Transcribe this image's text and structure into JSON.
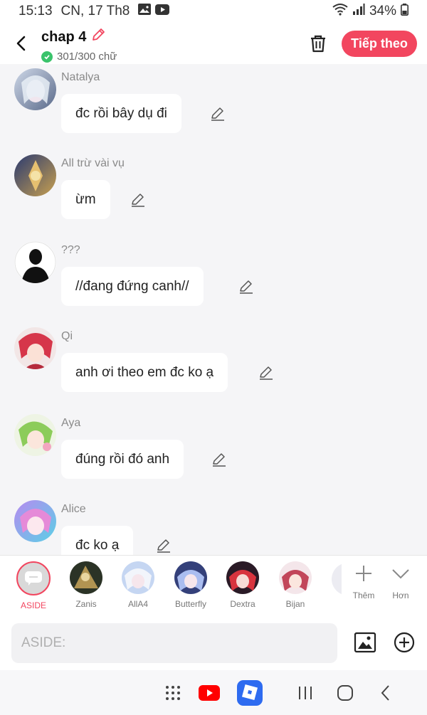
{
  "status_bar": {
    "time": "15:13",
    "date": "CN, 17 Th8",
    "battery": "34%",
    "icons": [
      "gallery-icon",
      "youtube-icon",
      "wifi-icon",
      "signal-icon",
      "battery-icon"
    ]
  },
  "header": {
    "title": "chap 4",
    "word_count": "301/300 chữ",
    "next_label": "Tiếp theo"
  },
  "messages": [
    {
      "sender": "Natalya",
      "text": "đc rồi bây dụ đi"
    },
    {
      "sender": "All trừ vài vụ",
      "text": "ừm"
    },
    {
      "sender": "???",
      "text": "//đang đứng canh//"
    },
    {
      "sender": "Qi",
      "text": "anh ơi theo em đc ko ạ"
    },
    {
      "sender": "Aya",
      "text": "đúng rồi đó anh"
    },
    {
      "sender": "Alice",
      "text": "đc ko ạ"
    }
  ],
  "characters": [
    {
      "name": "ASIDE",
      "active": true
    },
    {
      "name": "Zanis"
    },
    {
      "name": "AllA4"
    },
    {
      "name": "Butterfly"
    },
    {
      "name": "Dextra"
    },
    {
      "name": "Bijan"
    }
  ],
  "char_actions": {
    "more_label": "Thêm",
    "expand_label": "Hơn"
  },
  "input": {
    "placeholder": "ASIDE:"
  },
  "colors": {
    "accent": "#f2465f",
    "check": "#3ac36b",
    "background": "#f5f5f7"
  }
}
